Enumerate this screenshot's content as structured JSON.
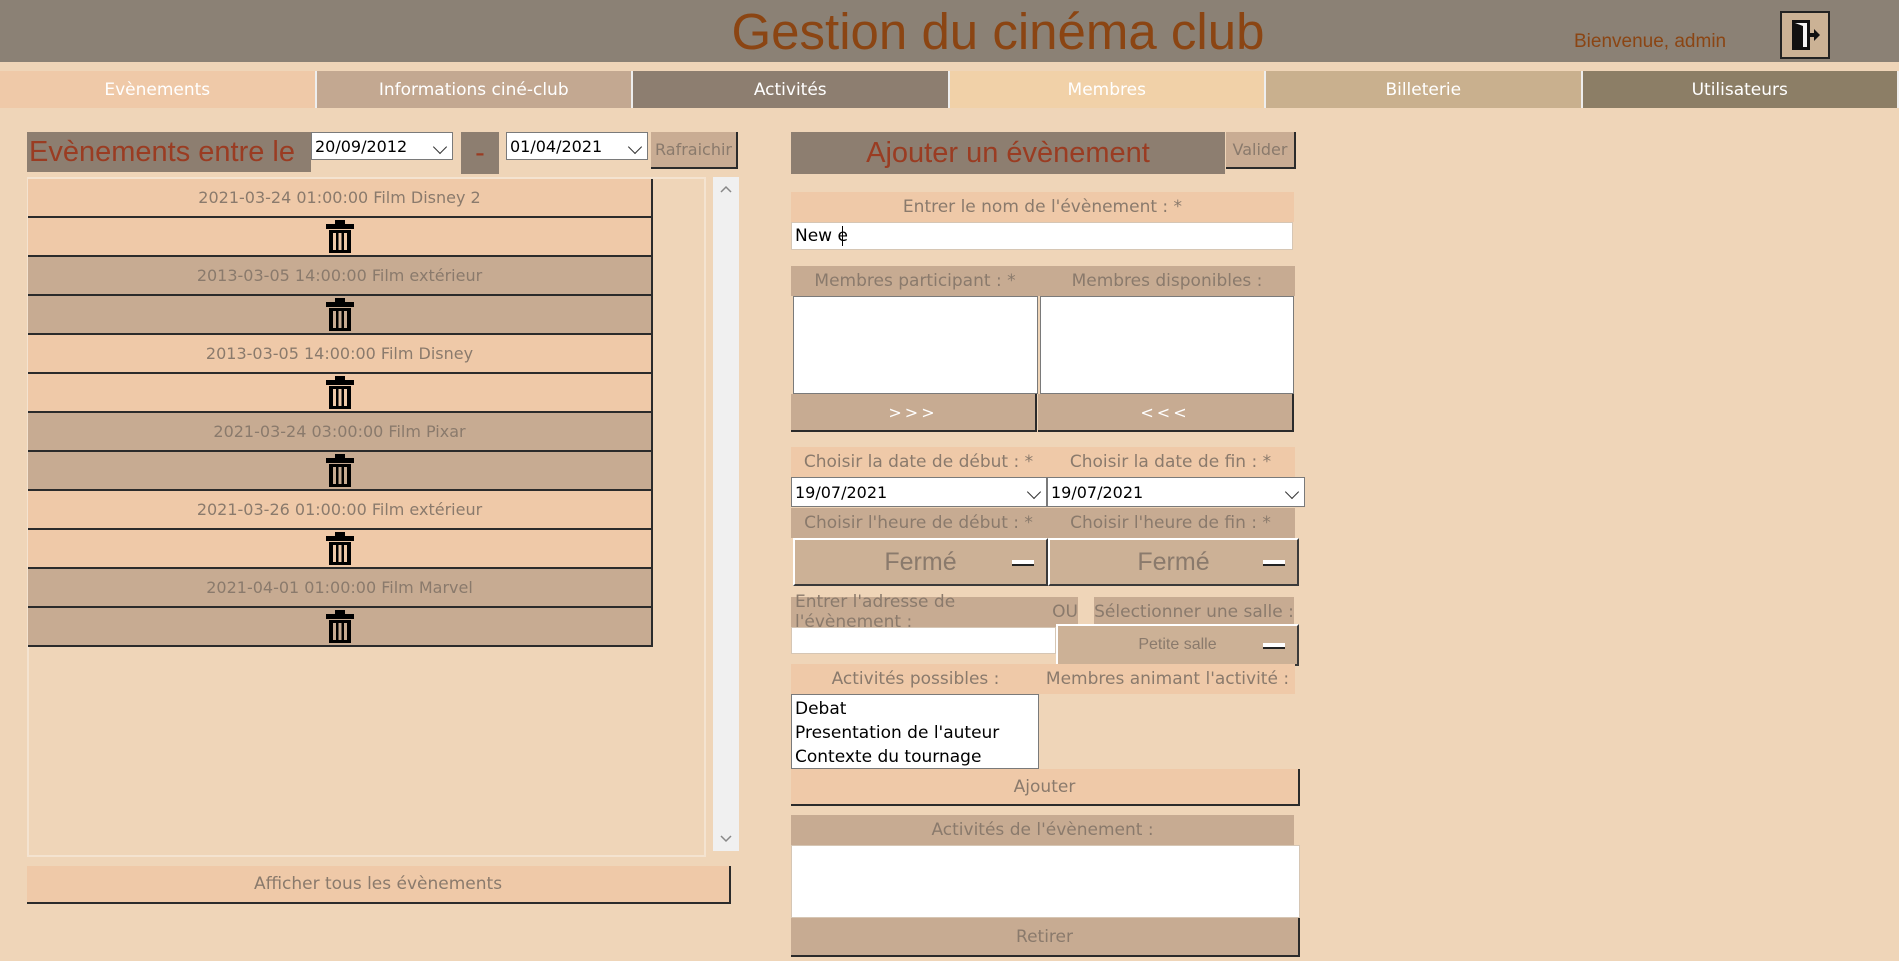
{
  "header": {
    "title": "Gestion du cinéma club",
    "welcome": "Bienvenue, admin"
  },
  "nav": {
    "tabs": [
      {
        "label": "Evènements",
        "bg": "#efc9a8"
      },
      {
        "label": "Informations ciné-club",
        "bg": "#c3a891"
      },
      {
        "label": "Activités",
        "bg": "#8d7e70"
      },
      {
        "label": "Membres",
        "bg": "#f1d1a8"
      },
      {
        "label": "Billeterie",
        "bg": "#c9b08e"
      },
      {
        "label": "Utilisateurs",
        "bg": "#8c7e66"
      }
    ]
  },
  "events_panel": {
    "title": "Evènements entre le",
    "start_date": "20/09/2012",
    "separator": "-",
    "end_date": "01/04/2021",
    "refresh_label": "Rafraichir",
    "events": [
      {
        "label": "2021-03-24 01:00:00 Film Disney 2"
      },
      {
        "label": "2013-03-05 14:00:00 Film extérieur"
      },
      {
        "label": "2013-03-05 14:00:00 Film Disney"
      },
      {
        "label": "2021-03-24 03:00:00 Film Pixar"
      },
      {
        "label": "2021-03-26 01:00:00 Film extérieur"
      },
      {
        "label": "2021-04-01 01:00:00 Film Marvel"
      }
    ],
    "show_all_label": "Afficher tous les évènements"
  },
  "add_panel": {
    "title": "Ajouter un évènement",
    "validate_label": "Valider",
    "name_label": "Entrer le nom de l'évènement : *",
    "name_value": "New e",
    "members_participating_label": "Membres participant : *",
    "members_available_label": "Membres disponibles :",
    "move_right_label": ">>>",
    "move_left_label": "<<<",
    "start_date_label": "Choisir la date de début : *",
    "end_date_label": "Choisir la date de fin : *",
    "start_date_value": "19/07/2021",
    "end_date_value": "19/07/2021",
    "start_time_label": "Choisir l'heure de début : *",
    "end_time_label": "Choisir l'heure de fin : *",
    "start_time_value": "Fermé",
    "end_time_value": "Fermé",
    "address_label": "Entrer l'adresse de l'évènement :",
    "or_label": "OU",
    "room_label": "Sélectionner une salle :",
    "room_value": "Petite salle",
    "activities_possible_label": "Activités possibles :",
    "activity_hosts_label": "Membres animant l'activité :",
    "activities_possible": [
      "Debat",
      "Presentation de l'auteur",
      "Contexte du tournage"
    ],
    "add_label": "Ajouter",
    "event_activities_label": "Activités de l'évènement :",
    "remove_label": "Retirer"
  }
}
